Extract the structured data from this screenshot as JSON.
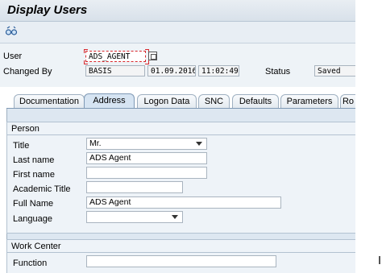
{
  "window": {
    "title": "Display Users"
  },
  "toolbar": {
    "icon": "glasses-icon"
  },
  "header": {
    "user_label": "User",
    "user_value": "ADS_AGENT",
    "changed_by_label": "Changed By",
    "changed_by_value": "BASIS",
    "changed_date": "01.09.2016",
    "changed_time": "11:02:49",
    "status_label": "Status",
    "status_value": "Saved"
  },
  "tabs": [
    {
      "label": "Documentation"
    },
    {
      "label": "Address"
    },
    {
      "label": "Logon Data"
    },
    {
      "label": "SNC"
    },
    {
      "label": "Defaults"
    },
    {
      "label": "Parameters"
    },
    {
      "label": "Ro"
    }
  ],
  "person": {
    "title": "Person",
    "fields": {
      "title_label": "Title",
      "title_value": "Mr.",
      "last_name_label": "Last name",
      "last_name_value": "ADS Agent",
      "first_name_label": "First name",
      "first_name_value": "",
      "academic_title_label": "Academic Title",
      "academic_title_value": "",
      "full_name_label": "Full Name",
      "full_name_value": "ADS Agent",
      "language_label": "Language",
      "language_value": ""
    }
  },
  "work_center": {
    "title": "Work Center",
    "function_label": "Function",
    "function_value": ""
  }
}
